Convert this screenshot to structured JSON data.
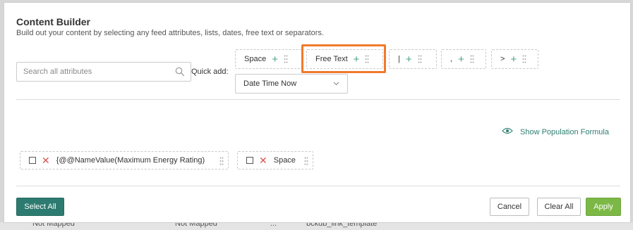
{
  "backdrop": {
    "cells": [
      "Not Mapped",
      "Not Mapped",
      "...",
      "bckdb_link_template"
    ]
  },
  "modal": {
    "title": "Content Builder",
    "subtitle": "Build out your content by selecting any feed attributes, lists, dates, free text or separators."
  },
  "search": {
    "placeholder": "Search all attributes",
    "icon": "search-icon"
  },
  "quick_add": {
    "label": "Quick add:",
    "chips": [
      {
        "label": "Space",
        "icon": "plus-icon"
      },
      {
        "label": "Free Text",
        "icon": "plus-icon",
        "highlighted": true
      },
      {
        "label": "|",
        "icon": "plus-icon"
      },
      {
        "label": ",",
        "icon": "plus-icon"
      },
      {
        "label": ">",
        "icon": "plus-icon"
      }
    ],
    "date_select": {
      "value": "Date Time Now",
      "icon": "chevron-down-icon"
    }
  },
  "formula_link": {
    "label": "Show Population Formula",
    "icon": "eye-icon"
  },
  "content_items": [
    {
      "label": "{@@NameValue(Maximum Energy Rating)",
      "checked": false
    },
    {
      "label": "Space",
      "checked": false
    }
  ],
  "footer": {
    "select_all": "Select All",
    "cancel": "Cancel",
    "clear_all": "Clear All",
    "apply": "Apply"
  },
  "colors": {
    "accent_teal": "#2d7b70",
    "apply_green": "#7cb846",
    "highlight_orange": "#f07a2b",
    "remove_red": "#d9534f"
  }
}
